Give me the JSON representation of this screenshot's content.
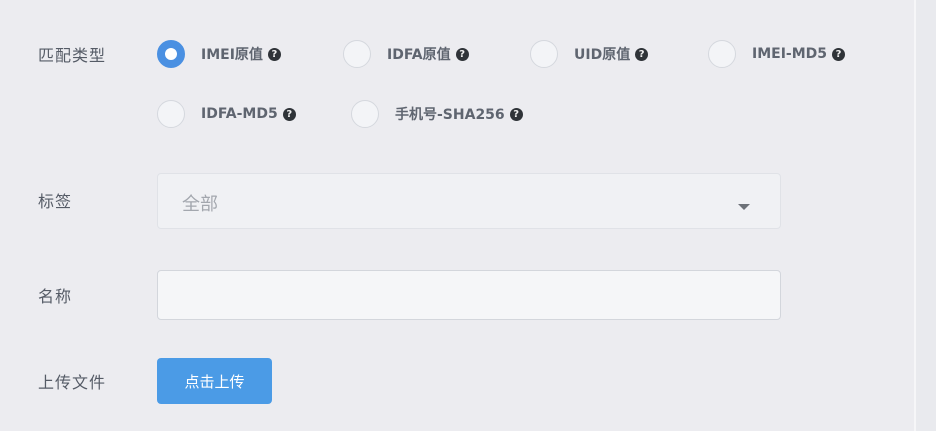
{
  "form": {
    "match_type": {
      "label": "匹配类型",
      "options": [
        {
          "label": "IMEI原值",
          "checked": true,
          "help_icon": "question-circle-icon"
        },
        {
          "label": "IDFA原值",
          "checked": false,
          "help_icon": "question-circle-icon"
        },
        {
          "label": "UID原值",
          "checked": false,
          "help_icon": "question-circle-icon"
        },
        {
          "label": "IMEI-MD5",
          "checked": false,
          "help_icon": "question-circle-icon"
        },
        {
          "label": "IDFA-MD5",
          "checked": false,
          "help_icon": "question-circle-icon"
        },
        {
          "label": "手机号-SHA256",
          "checked": false,
          "help_icon": "question-circle-icon"
        }
      ]
    },
    "tag": {
      "label": "标签",
      "selected": "全部",
      "dropdown_icon": "caret-down-icon"
    },
    "name": {
      "label": "名称",
      "value": "",
      "placeholder": ""
    },
    "upload": {
      "label": "上传文件",
      "button_label": "点击上传"
    }
  },
  "colors": {
    "accent": "#4a90e2",
    "button": "#4b9be6",
    "background": "#ececf0"
  }
}
